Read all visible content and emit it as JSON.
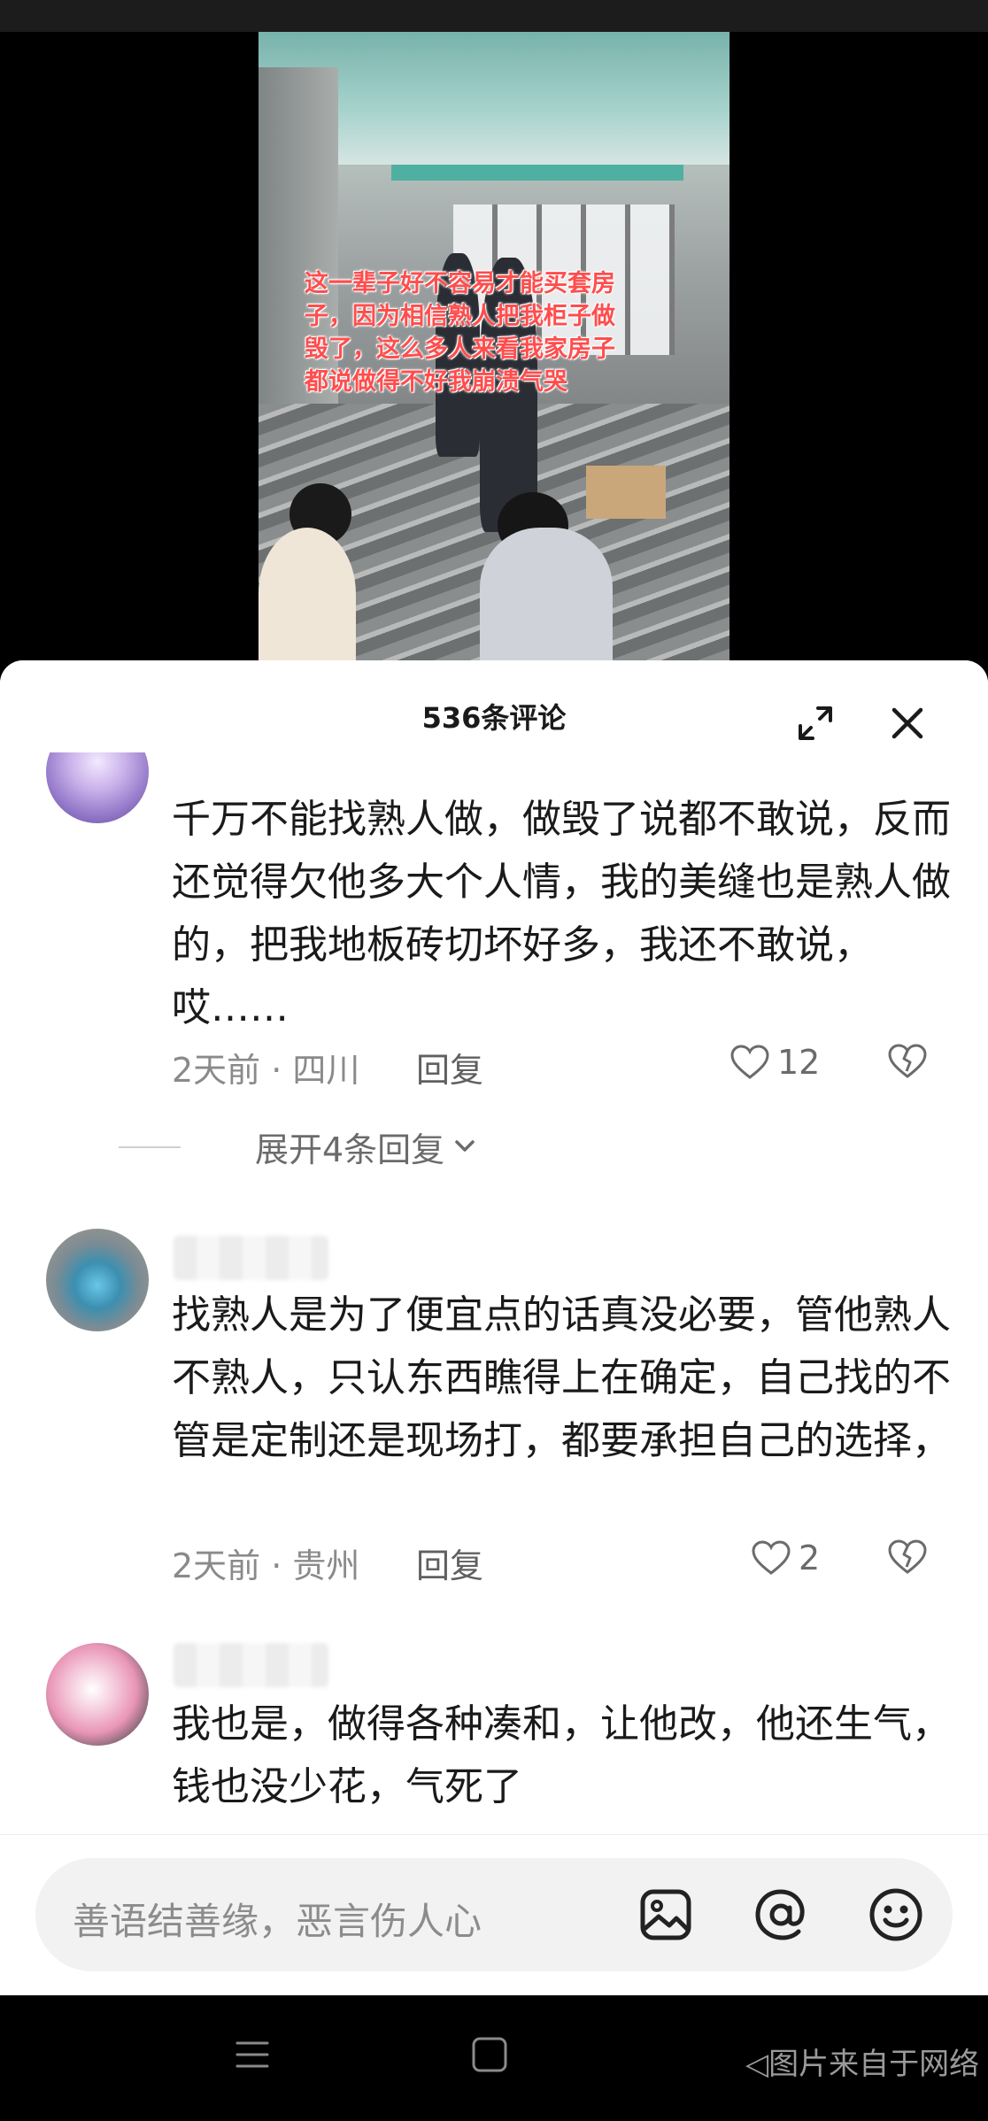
{
  "video": {
    "caption": "这一辈子好不容易才能买套房\n子，因为相信熟人把我柜子做\n毁了，这么多人来看我家房子\n都说做得不好我崩溃气哭"
  },
  "comments_panel": {
    "title": "536条评论",
    "comments": [
      {
        "text": "千万不能找熟人做，做毁了说都不敢说，反而还觉得欠他多大个人情，我的美缝也是熟人做的，把我地板砖切坏好多，我还不敢说，哎……",
        "time_location": "2天前 · 四川",
        "reply_label": "回复",
        "likes": "12",
        "expand_replies": "展开4条回复"
      },
      {
        "text": "找熟人是为了便宜点的话真没必要，管他熟人不熟人，只认东西瞧得上在确定，自己找的不管是定制还是现场打，都要承担自己的选择，",
        "time_location": "2天前 · 贵州",
        "reply_label": "回复",
        "likes": "2"
      },
      {
        "text": "我也是，做得各种凑和，让他改，他还生气，钱也没少花，气死了"
      }
    ]
  },
  "input": {
    "placeholder": "善语结善缘，恶言伤人心"
  },
  "navbar": {
    "watermark": "◁图片来自于网络"
  }
}
